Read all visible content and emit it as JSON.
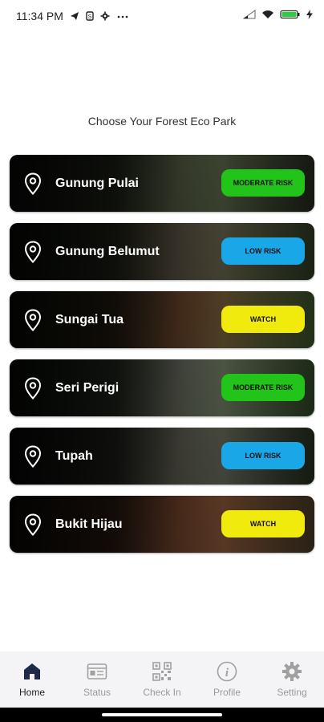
{
  "status_bar": {
    "time": "11:34 PM",
    "battery_color": "#2ecc40"
  },
  "page": {
    "title": "Choose Your Forest Eco Park"
  },
  "parks": [
    {
      "name": "Gunung Pulai",
      "status": "MODERATE RISK",
      "status_color": "#22c41a",
      "bg": [
        "#3d4a36",
        "#6f7a58",
        "#2b3323"
      ]
    },
    {
      "name": "Gunung Belumut",
      "status": "LOW RISK",
      "status_color": "#1aa7e8",
      "bg": [
        "#2f4a2c",
        "#7b6f5a",
        "#3a4b2d"
      ]
    },
    {
      "name": "Sungai Tua",
      "status": "WATCH",
      "status_color": "#f1ea0d",
      "bg": [
        "#3a4a2b",
        "#8b5a3a",
        "#4a6a38"
      ]
    },
    {
      "name": "Seri Perigi",
      "status": "MODERATE RISK",
      "status_color": "#22c41a",
      "bg": [
        "#304a2a",
        "#8a8f7d",
        "#3c5a2f"
      ]
    },
    {
      "name": "Tupah",
      "status": "LOW RISK",
      "status_color": "#1aa7e8",
      "bg": [
        "#2a3328",
        "#808070",
        "#2e3a27"
      ]
    },
    {
      "name": "Bukit Hijau",
      "status": "WATCH",
      "status_color": "#f1ea0d",
      "bg": [
        "#4a3a2a",
        "#9a5a3a",
        "#5a4a30"
      ]
    }
  ],
  "nav": {
    "items": [
      {
        "label": "Home",
        "icon": "home-icon",
        "active": true
      },
      {
        "label": "Status",
        "icon": "status-card-icon",
        "active": false
      },
      {
        "label": "Check In",
        "icon": "qr-code-icon",
        "active": false
      },
      {
        "label": "Profile",
        "icon": "info-icon",
        "active": false
      },
      {
        "label": "Setting",
        "icon": "gear-icon",
        "active": false
      }
    ],
    "active_color": "#1f2a4a",
    "inactive_color": "#a0a0a0"
  }
}
